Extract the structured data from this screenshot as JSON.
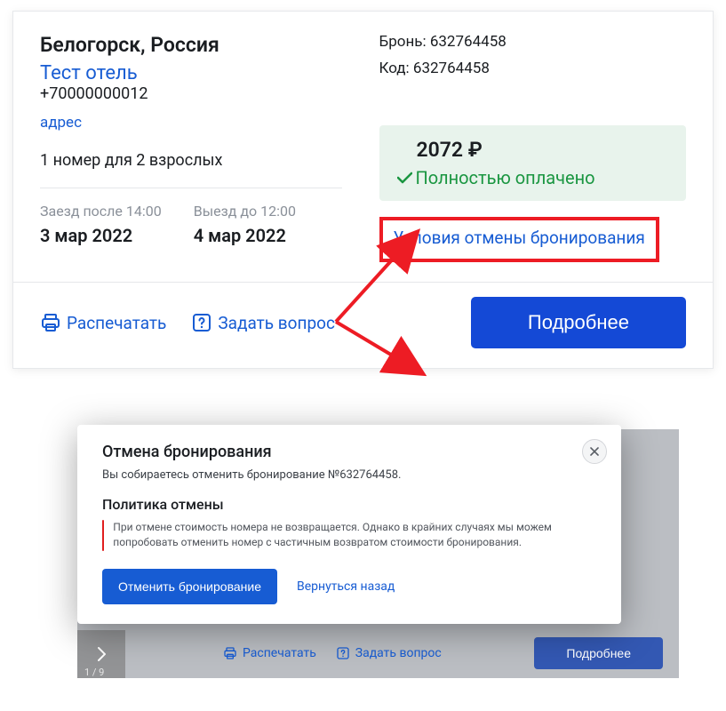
{
  "card": {
    "location": "Белогорск, Россия",
    "hotel_name": "Тест отель",
    "phone": "+70000000012",
    "address_link": "адрес",
    "guests": "1 номер для 2 взрослых",
    "checkin_label": "Заезд после 14:00",
    "checkin_date": "3 мар 2022",
    "checkout_label": "Выезд до 12:00",
    "checkout_date": "4 мар 2022",
    "booking_label": "Бронь: 632764458",
    "code_label": "Код: 632764458",
    "price": "2072 ₽",
    "paid_status": "Полностью оплачено",
    "cancel_link": "Условия отмены бронирования",
    "print_label": "Распечатать",
    "ask_label": "Задать вопрос",
    "more_button": "Подробнее"
  },
  "backdrop": {
    "print_label": "Распечатать",
    "ask_label": "Задать вопрос",
    "more_button": "Подробнее",
    "carousel_count": "1 / 9"
  },
  "modal": {
    "title": "Отмена бронирования",
    "subtitle": "Вы собираетесь отменить бронирование №632764458.",
    "section": "Политика отмены",
    "policy": "При отмене стоимость номера не возвращается. Однако в крайних случаях мы можем попробовать отменить номер с частичным возвратом стоимости бронирования.",
    "cancel_button": "Отменить бронирование",
    "back_link": "Вернуться назад"
  }
}
